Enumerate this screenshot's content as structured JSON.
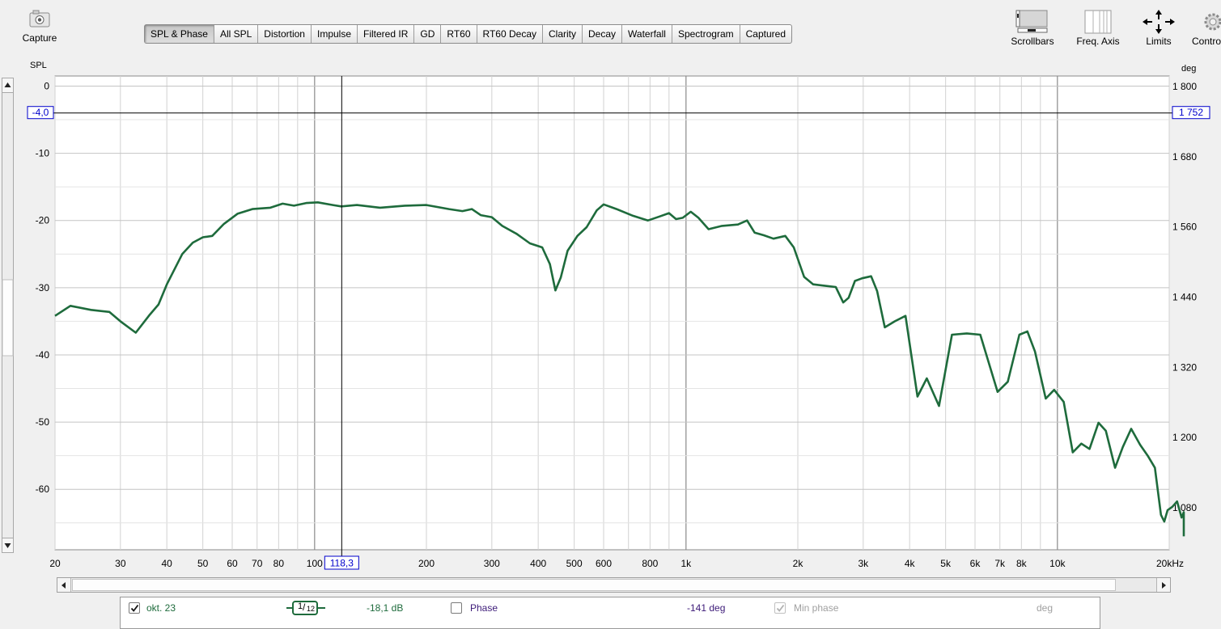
{
  "toolbar": {
    "capture_label": "Capture",
    "tabs": [
      {
        "label": "SPL & Phase",
        "active": true
      },
      {
        "label": "All SPL"
      },
      {
        "label": "Distortion"
      },
      {
        "label": "Impulse"
      },
      {
        "label": "Filtered IR"
      },
      {
        "label": "GD"
      },
      {
        "label": "RT60"
      },
      {
        "label": "RT60 Decay"
      },
      {
        "label": "Clarity"
      },
      {
        "label": "Decay"
      },
      {
        "label": "Waterfall"
      },
      {
        "label": "Spectrogram"
      },
      {
        "label": "Captured"
      }
    ],
    "right_tools": {
      "scrollbars": "Scrollbars",
      "freq_axis": "Freq. Axis",
      "limits": "Limits",
      "controls": "Contro"
    }
  },
  "left_axis_title": "SPL",
  "right_axis_title": "deg",
  "cursor": {
    "y_readout_left": "-4,0",
    "y_readout_right": "1 752",
    "x_readout": "118,3"
  },
  "chart_data": {
    "type": "line",
    "x_scale": "log",
    "xlim": [
      20,
      20000
    ],
    "ylim": [
      -69,
      1.5
    ],
    "y2lim": [
      1008,
      1818
    ],
    "grid": true,
    "x_tick_labels": [
      "20",
      "30",
      "40",
      "50",
      "60",
      "70",
      "80",
      "100",
      "200",
      "300",
      "400",
      "500",
      "600",
      "800",
      "1k",
      "2k",
      "3k",
      "4k",
      "5k",
      "6k",
      "7k",
      "8k",
      "10k",
      "20kHz"
    ],
    "x_tick_values": [
      20,
      30,
      40,
      50,
      60,
      70,
      80,
      100,
      200,
      300,
      400,
      500,
      600,
      800,
      1000,
      2000,
      3000,
      4000,
      5000,
      6000,
      7000,
      8000,
      10000,
      20000
    ],
    "y_tick_labels": [
      "0",
      "-10",
      "-20",
      "-30",
      "-40",
      "-50",
      "-60"
    ],
    "y_tick_values": [
      0,
      -10,
      -20,
      -30,
      -40,
      -50,
      -60
    ],
    "y2_tick_labels": [
      "1 800",
      "1 680",
      "1 560",
      "1 440",
      "1 320",
      "1 200",
      "1 080"
    ],
    "y2_tick_values": [
      1800,
      1680,
      1560,
      1440,
      1320,
      1200,
      1080
    ],
    "cursor_x": 118.3,
    "cursor_y": -4.0,
    "series": [
      {
        "name": "okt. 23",
        "color": "#1e6b3c",
        "points": [
          [
            20,
            -34.2
          ],
          [
            22,
            -32.7
          ],
          [
            25,
            -33.3
          ],
          [
            28,
            -33.6
          ],
          [
            30,
            -35.0
          ],
          [
            33,
            -36.7
          ],
          [
            36,
            -34.0
          ],
          [
            38,
            -32.5
          ],
          [
            40,
            -29.5
          ],
          [
            44,
            -25.0
          ],
          [
            47,
            -23.3
          ],
          [
            50,
            -22.5
          ],
          [
            53,
            -22.3
          ],
          [
            57,
            -20.5
          ],
          [
            62,
            -19.0
          ],
          [
            68,
            -18.3
          ],
          [
            76,
            -18.1
          ],
          [
            82,
            -17.5
          ],
          [
            88,
            -17.8
          ],
          [
            95,
            -17.4
          ],
          [
            102,
            -17.3
          ],
          [
            112,
            -17.7
          ],
          [
            118,
            -17.9
          ],
          [
            130,
            -17.7
          ],
          [
            150,
            -18.1
          ],
          [
            175,
            -17.8
          ],
          [
            200,
            -17.7
          ],
          [
            230,
            -18.3
          ],
          [
            250,
            -18.6
          ],
          [
            265,
            -18.3
          ],
          [
            280,
            -19.2
          ],
          [
            300,
            -19.5
          ],
          [
            320,
            -20.8
          ],
          [
            350,
            -22.0
          ],
          [
            380,
            -23.4
          ],
          [
            410,
            -24.0
          ],
          [
            430,
            -26.5
          ],
          [
            445,
            -30.4
          ],
          [
            460,
            -28.5
          ],
          [
            480,
            -24.5
          ],
          [
            510,
            -22.3
          ],
          [
            540,
            -21.0
          ],
          [
            575,
            -18.5
          ],
          [
            600,
            -17.6
          ],
          [
            650,
            -18.3
          ],
          [
            720,
            -19.3
          ],
          [
            790,
            -20.0
          ],
          [
            850,
            -19.4
          ],
          [
            900,
            -18.9
          ],
          [
            940,
            -19.8
          ],
          [
            980,
            -19.6
          ],
          [
            1030,
            -18.7
          ],
          [
            1080,
            -19.6
          ],
          [
            1150,
            -21.3
          ],
          [
            1250,
            -20.8
          ],
          [
            1380,
            -20.6
          ],
          [
            1460,
            -20.0
          ],
          [
            1530,
            -21.8
          ],
          [
            1620,
            -22.2
          ],
          [
            1720,
            -22.7
          ],
          [
            1850,
            -22.3
          ],
          [
            1950,
            -24.0
          ],
          [
            2080,
            -28.4
          ],
          [
            2200,
            -29.5
          ],
          [
            2350,
            -29.7
          ],
          [
            2530,
            -29.9
          ],
          [
            2650,
            -32.2
          ],
          [
            2740,
            -31.5
          ],
          [
            2850,
            -29.0
          ],
          [
            2980,
            -28.6
          ],
          [
            3150,
            -28.3
          ],
          [
            3270,
            -30.5
          ],
          [
            3430,
            -35.9
          ],
          [
            3650,
            -35.0
          ],
          [
            3900,
            -34.2
          ],
          [
            4200,
            -46.2
          ],
          [
            4450,
            -43.5
          ],
          [
            4800,
            -47.6
          ],
          [
            5200,
            -37.0
          ],
          [
            5700,
            -36.8
          ],
          [
            6200,
            -37.0
          ],
          [
            6900,
            -45.5
          ],
          [
            7350,
            -44.0
          ],
          [
            7900,
            -37.0
          ],
          [
            8300,
            -36.5
          ],
          [
            8700,
            -39.5
          ],
          [
            9300,
            -46.5
          ],
          [
            9800,
            -45.2
          ],
          [
            10400,
            -47.0
          ],
          [
            11000,
            -54.5
          ],
          [
            11600,
            -53.2
          ],
          [
            12200,
            -54.0
          ],
          [
            12900,
            -50.1
          ],
          [
            13500,
            -51.3
          ],
          [
            14300,
            -56.8
          ],
          [
            15000,
            -53.7
          ],
          [
            15800,
            -51.0
          ],
          [
            16700,
            -53.4
          ],
          [
            17500,
            -55.0
          ],
          [
            18300,
            -56.8
          ],
          [
            19000,
            -63.8
          ],
          [
            19400,
            -64.8
          ],
          [
            19800,
            -63.1
          ],
          [
            20400,
            -62.6
          ],
          [
            21000,
            -61.8
          ],
          [
            21600,
            -64.2
          ],
          [
            22100,
            -63.4
          ],
          [
            22700,
            -64.3
          ],
          [
            23400,
            -67.0
          ]
        ]
      }
    ]
  },
  "legend": {
    "series_name": "okt. 23",
    "smoothing_num": "1",
    "smoothing_den": "12",
    "spl_value": "-18,1 dB",
    "phase_label": "Phase",
    "phase_value": "-141 deg",
    "minphase_label": "Min phase",
    "minphase_value": "deg",
    "series_checked": true,
    "phase_checked": false,
    "minphase_checked": true
  },
  "colors": {
    "series": "#1e6b3c",
    "readout": "#0000cc",
    "phase_text": "#3c1a78",
    "disabled_text": "#a0a0a0"
  }
}
